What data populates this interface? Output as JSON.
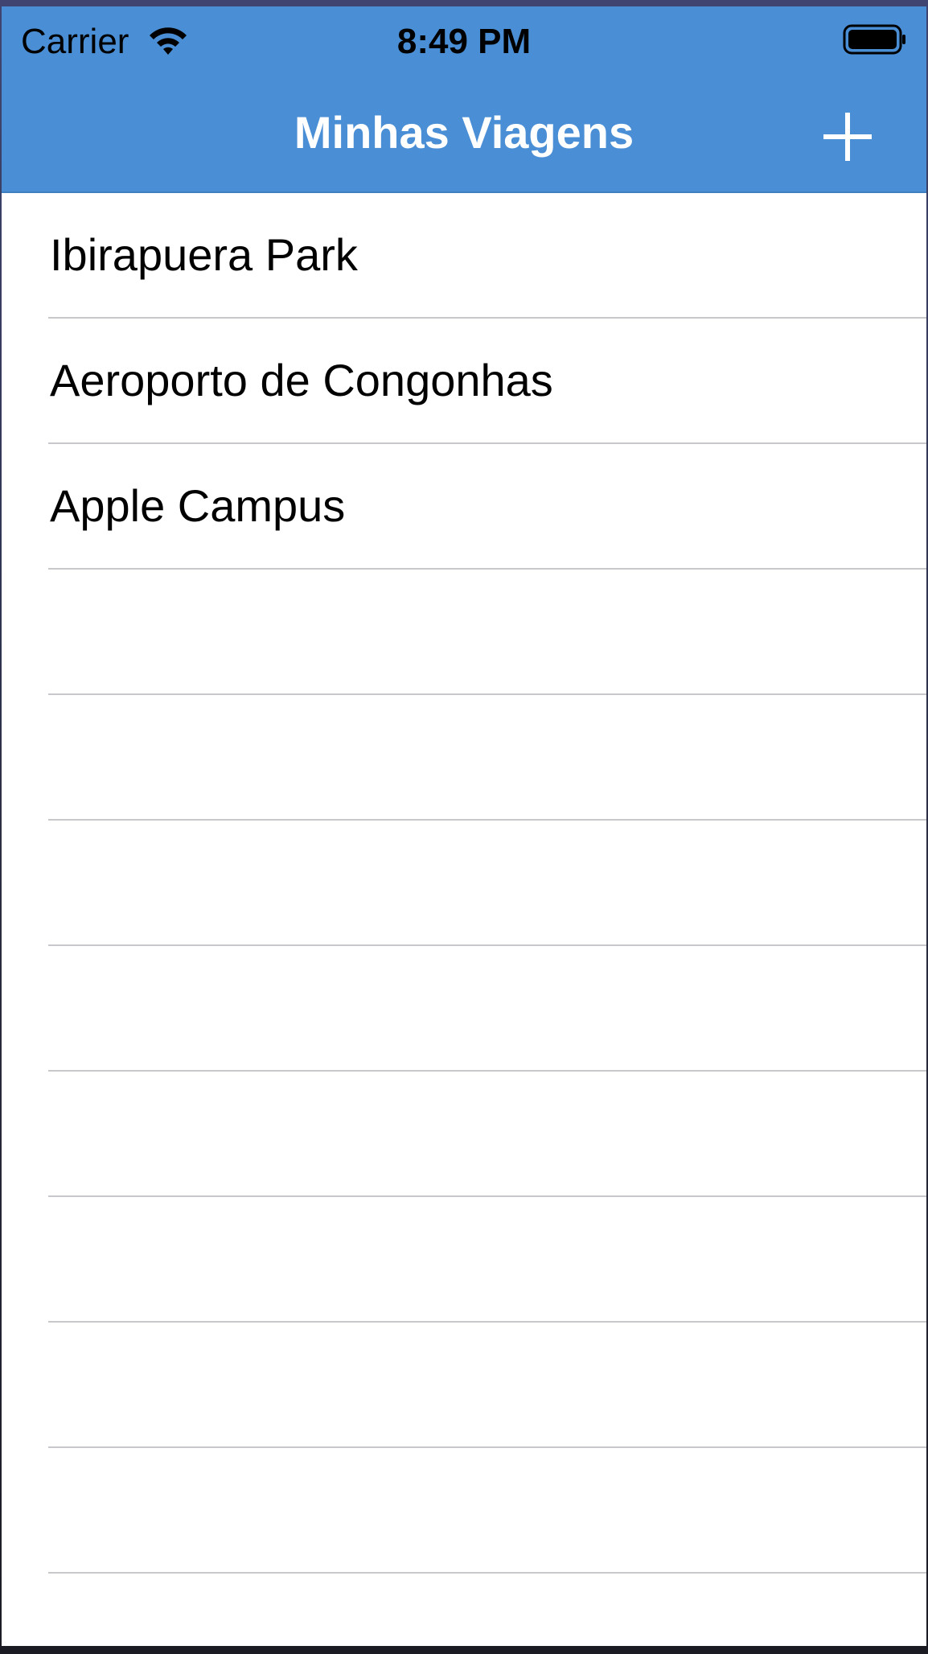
{
  "status_bar": {
    "carrier": "Carrier",
    "time": "8:49 PM",
    "wifi_icon": "wifi-icon",
    "battery_icon": "battery-icon"
  },
  "nav": {
    "title": "Minhas Viagens",
    "add_icon": "plus-icon",
    "bar_color": "#4a8fd5"
  },
  "trips": [
    {
      "label": "Ibirapuera Park"
    },
    {
      "label": "Aeroporto de Congonhas"
    },
    {
      "label": "Apple Campus"
    },
    {
      "label": ""
    },
    {
      "label": ""
    },
    {
      "label": ""
    },
    {
      "label": ""
    },
    {
      "label": ""
    },
    {
      "label": ""
    },
    {
      "label": ""
    },
    {
      "label": ""
    },
    {
      "label": ""
    }
  ]
}
